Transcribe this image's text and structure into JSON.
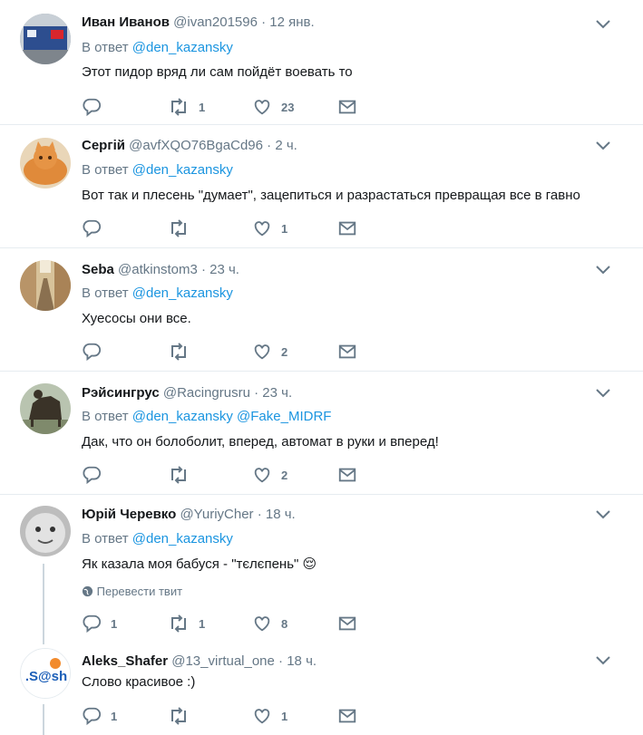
{
  "ui": {
    "reply_prefix": "В ответ",
    "translate_label": "Перевести твит",
    "accent": "#1b95e0",
    "muted": "#657786"
  },
  "tweets": [
    {
      "name": "Иван Иванов",
      "handle": "@ivan201596",
      "time": "12 янв.",
      "mentions": [
        "@den_kazansky"
      ],
      "text": "Этот пидор вряд ли сам пойдёт воевать то",
      "replies": "",
      "retweets": "1",
      "likes": "23",
      "avatar": "bank-sign-photo"
    },
    {
      "name": "Сергій",
      "handle": "@avfXQO76BgaCd96",
      "time": "2 ч.",
      "mentions": [
        "@den_kazansky"
      ],
      "text": "Вот так и плесень \"думает\", зацепиться и разрастаться превращая все в гавно",
      "replies": "",
      "retweets": "",
      "likes": "1",
      "avatar": "orange-cat-photo"
    },
    {
      "name": "Seba",
      "handle": "@atkinstom3",
      "time": "23 ч.",
      "mentions": [
        "@den_kazansky"
      ],
      "text": "Хуесосы они все.",
      "replies": "",
      "retweets": "",
      "likes": "2",
      "avatar": "alley-photo"
    },
    {
      "name": "Рэйсингрус",
      "handle": "@Racingrusru",
      "time": "23 ч.",
      "mentions": [
        "@den_kazansky",
        "@Fake_MIDRF"
      ],
      "text": "Дак, что он болоболит, вперед, автомат в руки и вперед!",
      "replies": "",
      "retweets": "",
      "likes": "2",
      "avatar": "horse-statue-photo"
    },
    {
      "name": "Юрій Черевко",
      "handle": "@YuriyCher",
      "time": "18 ч.",
      "mentions": [
        "@den_kazansky"
      ],
      "text": "Як казала моя бабуся - \"тєлєпень\"",
      "emoji": "😌",
      "replies": "1",
      "retweets": "1",
      "likes": "8",
      "avatar": "baby-face-photo"
    },
    {
      "name": "Aleks_Shafer",
      "handle": "@13_virtual_one",
      "time": "18 ч.",
      "text": "Слово красивое :)",
      "replies": "1",
      "retweets": "",
      "likes": "1",
      "avatar": "sash-logo",
      "avatar_text": ".S@sh"
    }
  ]
}
